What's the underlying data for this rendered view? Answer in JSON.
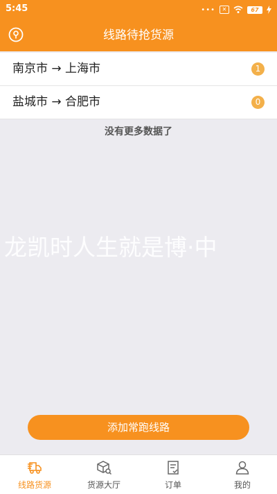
{
  "status_bar": {
    "time": "5:45",
    "battery": "67"
  },
  "header": {
    "title": "线路待抢货源"
  },
  "routes": [
    {
      "label": "南京市 → 上海市",
      "count": "1"
    },
    {
      "label": "盐城市 → 合肥市",
      "count": "0"
    }
  ],
  "list_footer": "没有更多数据了",
  "watermark": "龙凯时人生就是博·中",
  "add_button": "添加常跑线路",
  "nav": [
    {
      "label": "线路货源",
      "icon": "truck-route-icon",
      "active": true
    },
    {
      "label": "货源大厅",
      "icon": "package-search-icon",
      "active": false
    },
    {
      "label": "订单",
      "icon": "order-document-icon",
      "active": false
    },
    {
      "label": "我的",
      "icon": "user-icon",
      "active": false
    }
  ],
  "colors": {
    "accent": "#f7911f",
    "badge": "#f3b04a",
    "background": "#ecebf0"
  }
}
